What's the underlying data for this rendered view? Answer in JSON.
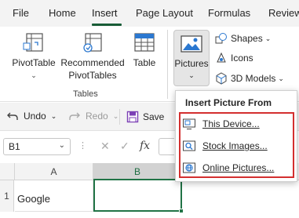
{
  "menu": {
    "tabs": [
      "File",
      "Home",
      "Insert",
      "Page Layout",
      "Formulas",
      "Review"
    ],
    "active_tab": "Insert"
  },
  "ribbon": {
    "pivot_table": "PivotTable",
    "recommended_line1": "Recommended",
    "recommended_line2": "PivotTables",
    "table": "Table",
    "tables_group": "Tables",
    "pictures": "Pictures",
    "shapes": "Shapes",
    "icons": "Icons",
    "models_3d": "3D Models"
  },
  "quick_access": {
    "undo": "Undo",
    "redo": "Redo",
    "save": "Save"
  },
  "formula_bar": {
    "name_box": "B1",
    "fx": "fx"
  },
  "grid": {
    "col_a": "A",
    "col_b": "B",
    "row_1": "1",
    "cell_a1": "Google"
  },
  "dropdown": {
    "title": "Insert Picture From",
    "items": [
      "This Device...",
      "Stock Images...",
      "Online Pictures..."
    ]
  }
}
